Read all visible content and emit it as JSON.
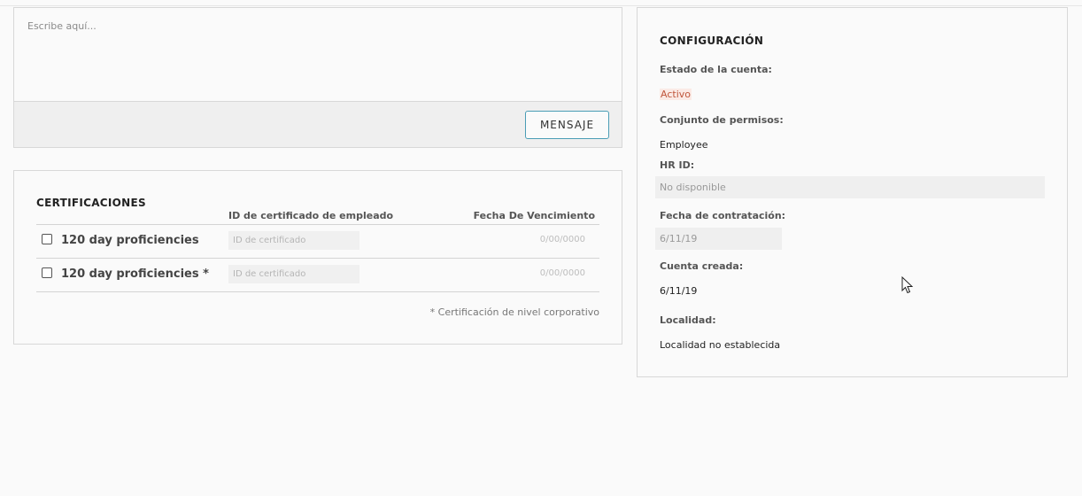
{
  "message": {
    "placeholder": "Escribe aquí...",
    "button_label": "MENSAJE"
  },
  "certifications": {
    "title": "CERTIFICACIONES",
    "col_id": "ID de certificado de empleado",
    "col_date": "Fecha De Vencimiento",
    "rows": [
      {
        "name": "120 day proficiencies",
        "id_placeholder": "ID de certificado",
        "date": "0/00/0000",
        "checked": false
      },
      {
        "name": "120 day proficiencies *",
        "id_placeholder": "ID de certificado",
        "date": "0/00/0000",
        "checked": false
      }
    ],
    "note": "* Certificación de nivel corporativo"
  },
  "config": {
    "title": "CONFIGURACIÓN",
    "account_status_label": "Estado de la cuenta:",
    "account_status_value": "Activo",
    "permissions_label": "Conjunto de permisos:",
    "permissions_value": "Employee",
    "hr_id_label": "HR ID:",
    "hr_id_value": "No disponible",
    "hire_date_label": "Fecha de contratación:",
    "hire_date_value": "6/11/19",
    "created_label": "Cuenta creada:",
    "created_value": "6/11/19",
    "location_label": "Localidad:",
    "location_value": "Localidad no establecida"
  },
  "colors": {
    "accent_border": "#4a9db5",
    "status_active_text": "#c0563c",
    "status_active_bg": "#fbeae5"
  }
}
